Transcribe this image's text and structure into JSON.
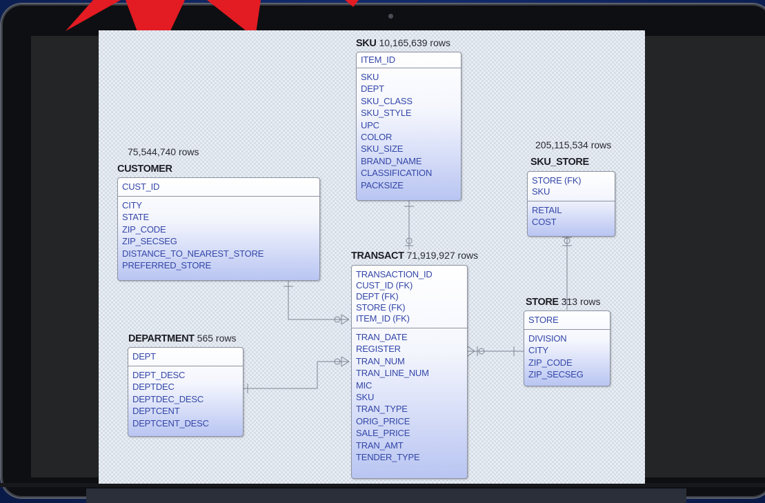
{
  "entities": {
    "sku": {
      "name": "SKU",
      "rows": "10,165,639 rows",
      "pk": [
        "ITEM_ID"
      ],
      "fields": [
        "SKU",
        "DEPT",
        "SKU_CLASS",
        "SKU_STYLE",
        "UPC",
        "COLOR",
        "SKU_SIZE",
        "BRAND_NAME",
        "CLASSIFICATION",
        "PACKSIZE"
      ]
    },
    "customer": {
      "name": "CUSTOMER",
      "rows": "75,544,740 rows",
      "pk": [
        "CUST_ID"
      ],
      "fields": [
        "CITY",
        "STATE",
        "ZIP_CODE",
        "ZIP_SECSEG",
        "DISTANCE_TO_NEAREST_STORE",
        "PREFERRED_STORE"
      ]
    },
    "sku_store": {
      "name": "SKU_STORE",
      "rows": "205,115,534 rows",
      "pk": [
        "STORE (FK)",
        "SKU"
      ],
      "fields": [
        "RETAIL",
        "COST"
      ]
    },
    "transact": {
      "name": "TRANSACT",
      "rows": "71,919,927 rows",
      "pk": [
        "TRANSACTION_ID",
        "CUST_ID (FK)",
        "DEPT (FK)",
        "STORE (FK)",
        "ITEM_ID (FK)"
      ],
      "fields": [
        "TRAN_DATE",
        "REGISTER",
        "TRAN_NUM",
        "TRAN_LINE_NUM",
        "MIC",
        "SKU",
        "TRAN_TYPE",
        "ORIG_PRICE",
        "SALE_PRICE",
        "TRAN_AMT",
        "TENDER_TYPE"
      ]
    },
    "store": {
      "name": "STORE",
      "rows": "313 rows",
      "pk": [
        "STORE"
      ],
      "fields": [
        "DIVISION",
        "CITY",
        "ZIP_CODE",
        "ZIP_SECSEG"
      ]
    },
    "department": {
      "name": "DEPARTMENT",
      "rows": "565 rows",
      "pk": [
        "DEPT"
      ],
      "fields": [
        "DEPT_DESC",
        "DEPTDEC",
        "DEPTDEC_DESC",
        "DEPTCENT",
        "DEPTCENT_DESC"
      ]
    }
  },
  "colors": {
    "entity_text": "#3346a8",
    "arrow": "#e31b23",
    "background": "#12296a"
  }
}
